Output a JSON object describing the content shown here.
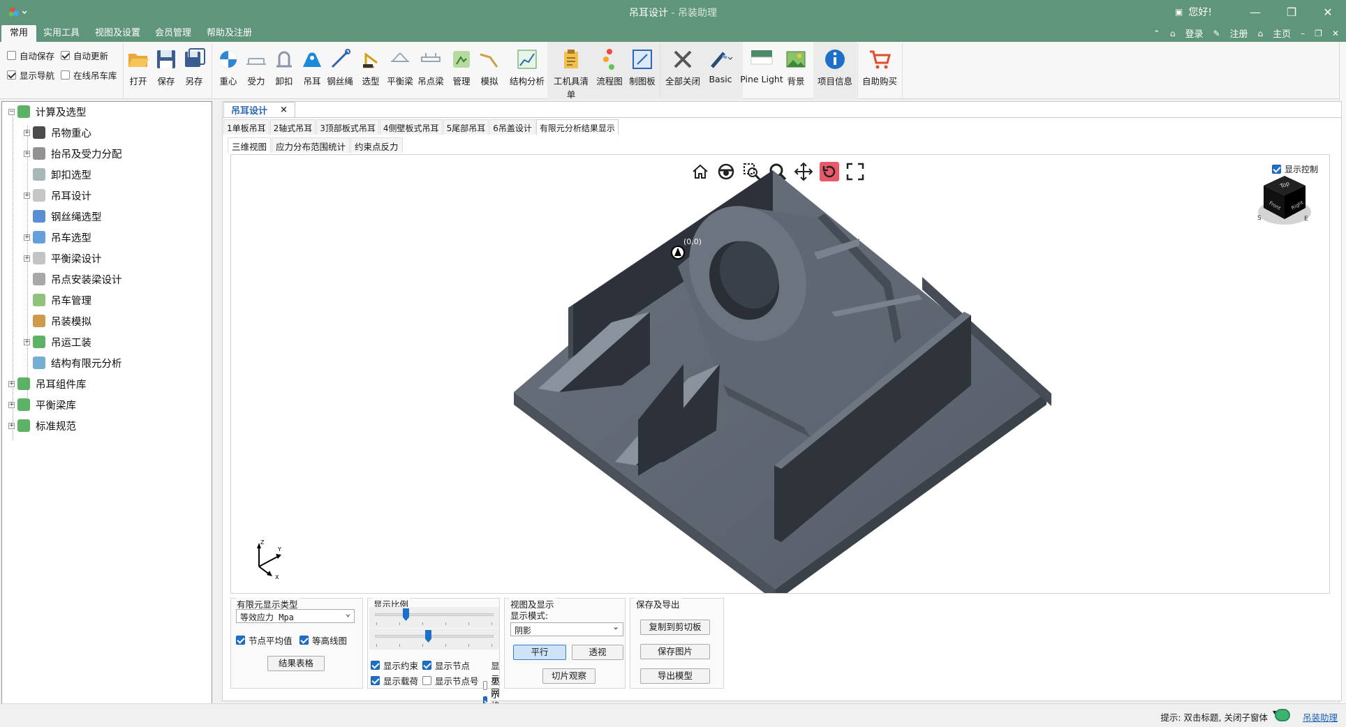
{
  "window": {
    "title": "吊耳设计",
    "subtitle": "吊装助理",
    "greeting": "您好!",
    "buttons": {
      "min": "—",
      "max": "❐",
      "close": "✕"
    }
  },
  "menu": {
    "tabs": [
      "常用",
      "实用工具",
      "视图及设置",
      "会员管理",
      "帮助及注册"
    ],
    "right": {
      "login": "登录",
      "register": "注册",
      "home": "主页"
    }
  },
  "ribbon": {
    "checks": [
      {
        "label": "自动保存",
        "checked": false
      },
      {
        "label": "自动更新",
        "checked": true
      },
      {
        "label": "显示导航",
        "checked": true
      },
      {
        "label": "在线吊车库",
        "checked": false
      }
    ],
    "file": [
      "打开",
      "保存",
      "另存"
    ],
    "calc": [
      "重心",
      "受力",
      "卸扣",
      "吊耳",
      "钢丝绳",
      "选型",
      "平衡梁",
      "吊点梁",
      "管理",
      "模拟",
      "结构分析"
    ],
    "tools": [
      "工机具清单",
      "流程图",
      "制图板"
    ],
    "view": [
      "全部关闭",
      "Basic",
      "Pine Light",
      "背景"
    ],
    "info": [
      "项目信息"
    ],
    "buy": [
      "自助购买"
    ]
  },
  "tree": [
    {
      "label": "计算及选型",
      "level": 0,
      "exp": "−"
    },
    {
      "label": "吊物重心",
      "level": 1,
      "exp": "+"
    },
    {
      "label": "抬吊及受力分配",
      "level": 1,
      "exp": "+"
    },
    {
      "label": "卸扣选型",
      "level": 1,
      "exp": ""
    },
    {
      "label": "吊耳设计",
      "level": 1,
      "exp": "+"
    },
    {
      "label": "钢丝绳选型",
      "level": 1,
      "exp": ""
    },
    {
      "label": "吊车选型",
      "level": 1,
      "exp": "+"
    },
    {
      "label": "平衡梁设计",
      "level": 1,
      "exp": "+"
    },
    {
      "label": "吊点安装梁设计",
      "level": 1,
      "exp": ""
    },
    {
      "label": "吊车管理",
      "level": 1,
      "exp": ""
    },
    {
      "label": "吊装模拟",
      "level": 1,
      "exp": ""
    },
    {
      "label": "吊运工装",
      "level": 1,
      "exp": "+"
    },
    {
      "label": "结构有限元分析",
      "level": 1,
      "exp": ""
    },
    {
      "label": "吊耳组件库",
      "level": 0,
      "exp": "+"
    },
    {
      "label": "平衡梁库",
      "level": 0,
      "exp": "+"
    },
    {
      "label": "标准规范",
      "level": 0,
      "exp": "+"
    }
  ],
  "doc": {
    "tab": "吊耳设计",
    "close": "×",
    "subtabs": [
      "1单板吊耳",
      "2轴式吊耳",
      "3顶部板式吊耳",
      "4侧壁板式吊耳",
      "5尾部吊耳",
      "6吊盖设计",
      "有限元分析结果显示"
    ],
    "viewtabs": [
      "三维视图",
      "应力分布范围统计",
      "约束点反力"
    ],
    "show_control": "显示控制",
    "node_label": "(0,0)",
    "cube_labels": {
      "top": "Top",
      "front": "Front",
      "right": "Right",
      "s": "S",
      "e": "E"
    },
    "axes": {
      "x": "X",
      "y": "Y",
      "z": "Z"
    }
  },
  "panel": {
    "fea_type_title": "有限元显示类型",
    "fea_type_value": "等效应力 Mpa",
    "node_avg": "节点平均值",
    "contour": "等高线图",
    "result_table": "结果表格",
    "scale_title": "显示比例",
    "scale1": 0.25,
    "scale2": 0.45,
    "chk": [
      {
        "label": "显示约束",
        "checked": true
      },
      {
        "label": "显示节点",
        "checked": true
      },
      {
        "label": "显示网格",
        "checked": false
      },
      {
        "label": "显示载荷",
        "checked": true
      },
      {
        "label": "显示节点号",
        "checked": false
      },
      {
        "label": "显示云图",
        "checked": true
      }
    ],
    "view_title": "视图及显示",
    "mode_label": "显示模式:",
    "mode_value": "阴影",
    "parallel": "平行",
    "perspective": "透视",
    "slice": "切片观察",
    "save_title": "保存及导出",
    "copy": "复制到剪切板",
    "save_img": "保存图片",
    "export": "导出模型"
  },
  "status": {
    "hint": "提示: 双击标题, 关闭子窗体",
    "link": "吊装助理"
  },
  "colors": {
    "titlebar": "#5f957a",
    "accent": "#1e6fc8",
    "model": "#5c6470"
  }
}
